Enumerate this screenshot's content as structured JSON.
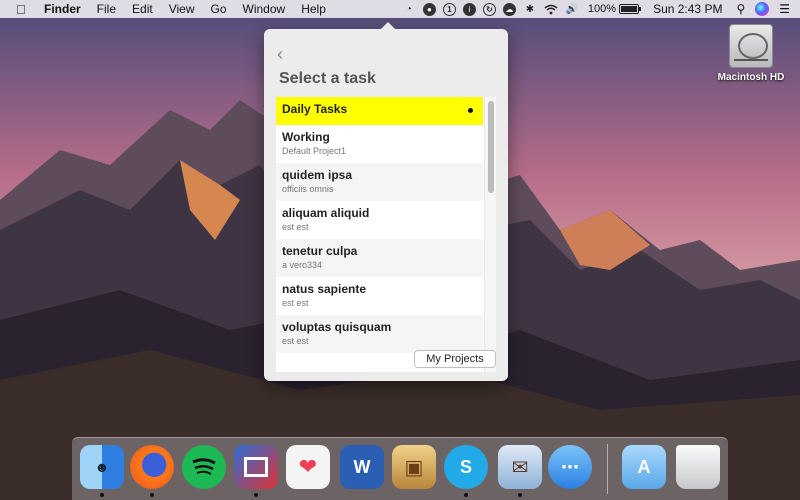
{
  "menubar": {
    "app_name": "Finder",
    "menus": [
      "File",
      "Edit",
      "View",
      "Go",
      "Window",
      "Help"
    ],
    "status_icons": [
      "timer-icon",
      "dark-icon",
      "1password-icon",
      "info-icon",
      "clock-circle-icon",
      "cloud-icon",
      "bluetooth-icon",
      "wifi-icon",
      "volume-icon"
    ],
    "one_label": "1",
    "battery_text": "100%",
    "battery_level": 1.0,
    "clock": "Sun 2:43 PM"
  },
  "desktop": {
    "disk_label": "Macintosh HD"
  },
  "popover": {
    "back_icon": "chevron-left-icon",
    "title": "Select a task",
    "tasks": [
      {
        "name": "Daily Tasks",
        "project": ""
      },
      {
        "name": "Working",
        "project": "Default Project1"
      },
      {
        "name": "quidem ipsa",
        "project": "officiis omnis"
      },
      {
        "name": "aliquam aliquid",
        "project": "est est"
      },
      {
        "name": "tenetur culpa",
        "project": "a vero334"
      },
      {
        "name": "natus sapiente",
        "project": "est est"
      },
      {
        "name": "voluptas quisquam",
        "project": "est est"
      }
    ],
    "my_projects_label": "My Projects"
  },
  "dock": {
    "apps": [
      "finder",
      "firefox",
      "spotify",
      "screens",
      "pocket",
      "word",
      "preview",
      "skype",
      "mail",
      "messages",
      "applications-folder",
      "trash"
    ]
  },
  "colors": {
    "selected_row": "#ffff00",
    "accent": "#3a74d8"
  }
}
